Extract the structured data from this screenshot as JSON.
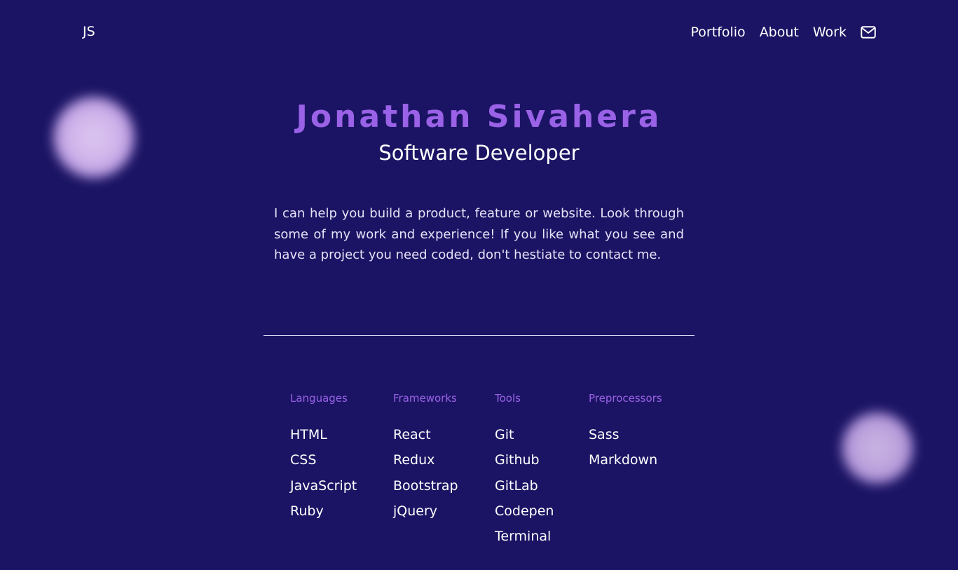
{
  "nav": {
    "logo": "JS",
    "links": [
      "Portfolio",
      "About",
      "Work"
    ],
    "contact_icon": "envelope-icon"
  },
  "hero": {
    "name": "Jonathan Sivahera",
    "title": "Software Developer",
    "intro": "I can help you build a product, feature or website. Look through some of my work and experience! If you like what you see and have a project you need coded, don't hestiate to contact me."
  },
  "skills": [
    {
      "heading": "Languages",
      "items": [
        "HTML",
        "CSS",
        "JavaScript",
        "Ruby"
      ]
    },
    {
      "heading": "Frameworks",
      "items": [
        "React",
        "Redux",
        "Bootstrap",
        "jQuery"
      ]
    },
    {
      "heading": "Tools",
      "items": [
        "Git",
        "Github",
        "GitLab",
        "Codepen",
        "Terminal"
      ]
    },
    {
      "heading": "Preprocessors",
      "items": [
        "Sass",
        "Markdown"
      ]
    }
  ],
  "colors": {
    "background": "#1b1464",
    "accent": "#9a62e6",
    "text": "#ffffff"
  }
}
